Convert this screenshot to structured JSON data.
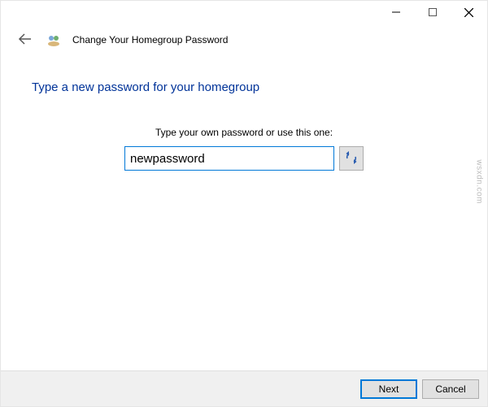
{
  "titlebar": {
    "minimize_icon": "minimize-icon",
    "maximize_icon": "maximize-icon",
    "close_icon": "close-icon"
  },
  "header": {
    "back_icon": "back-arrow-icon",
    "app_icon": "homegroup-icon",
    "title": "Change Your Homegroup Password"
  },
  "content": {
    "heading": "Type a new password for your homegroup",
    "prompt": "Type your own password or use this one:",
    "password_value": "newpassword",
    "regen_icon": "refresh-icon"
  },
  "footer": {
    "next_label": "Next",
    "cancel_label": "Cancel"
  },
  "watermark": "wsxdn.com"
}
